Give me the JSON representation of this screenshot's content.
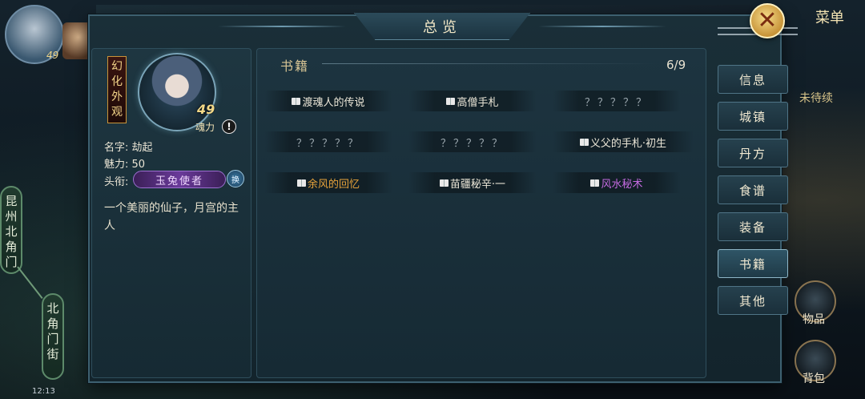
{
  "background": {
    "map_labels": [
      "昆州北角门",
      "北角门街"
    ],
    "status_time": "12:13",
    "menu_title": "菜单",
    "pending_text": "未待续",
    "side_items": [
      "物品",
      "背包"
    ]
  },
  "modal": {
    "title": "总览",
    "close_symbol": "✕"
  },
  "character": {
    "appearance_tag": [
      "幻",
      "化",
      "外",
      "观"
    ],
    "level": "49",
    "charm_label": "魂力",
    "info_symbol": "!",
    "name_label": "名字:",
    "name_value": "劫起",
    "charm_stat_label": "魅力:",
    "charm_stat_value": "50",
    "title_label": "头衔:",
    "title_value": "玉兔使者",
    "swap_label": "换",
    "description": "一个美丽的仙子，月宫的主人"
  },
  "books": {
    "section_title": "书籍",
    "count": "6/9",
    "items": [
      {
        "label": "渡魂人的传说",
        "unlocked": true,
        "color": "white"
      },
      {
        "label": "高僧手札",
        "unlocked": true,
        "color": "white"
      },
      {
        "label": "？？？？？",
        "unlocked": false,
        "color": "locked"
      },
      {
        "label": "？？？？？",
        "unlocked": false,
        "color": "locked"
      },
      {
        "label": "？？？？？",
        "unlocked": false,
        "color": "locked"
      },
      {
        "label": "义父的手札·初生",
        "unlocked": true,
        "color": "white"
      },
      {
        "label": "余风的回忆",
        "unlocked": true,
        "color": "gold"
      },
      {
        "label": "苗疆秘辛·一",
        "unlocked": true,
        "color": "white"
      },
      {
        "label": "风水秘术",
        "unlocked": true,
        "color": "purple"
      }
    ]
  },
  "tabs": [
    {
      "label": "信息",
      "active": false
    },
    {
      "label": "城镇",
      "active": false
    },
    {
      "label": "丹方",
      "active": false
    },
    {
      "label": "食谱",
      "active": false
    },
    {
      "label": "装备",
      "active": false
    },
    {
      "label": "书籍",
      "active": true
    },
    {
      "label": "其他",
      "active": false
    }
  ],
  "colors": {
    "accent_gold": "#e6a23a",
    "accent_purple": "#c46ae0",
    "panel_border": "#2f4e5c"
  }
}
